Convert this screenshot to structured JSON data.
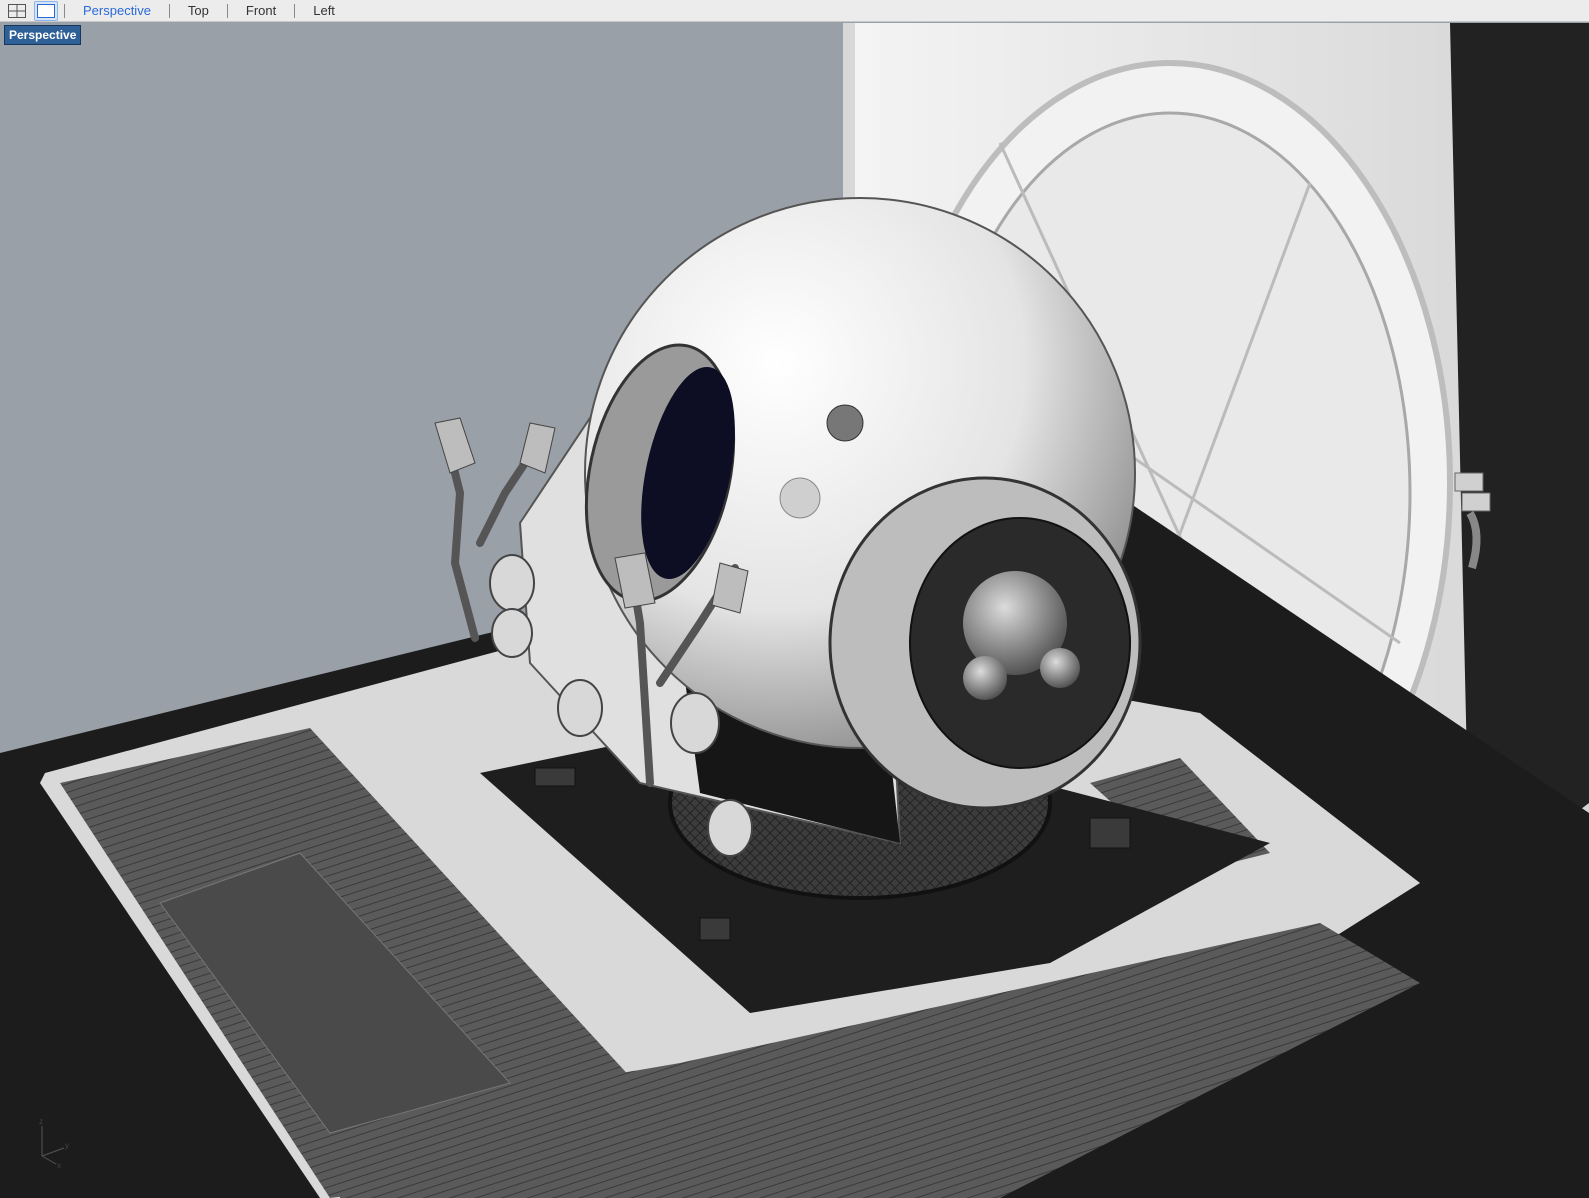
{
  "toolbar": {
    "layout_icon": "four-viewport-grid-icon",
    "single_icon": "single-viewport-icon",
    "tabs": [
      {
        "label": "Perspective",
        "active": true
      },
      {
        "label": "Top",
        "active": false
      },
      {
        "label": "Front",
        "active": false
      },
      {
        "label": "Left",
        "active": false
      }
    ],
    "accent_color": "#2a6ad6"
  },
  "viewport": {
    "label": "Perspective",
    "label_bg": "#2e5f96",
    "background": "#9aa0a8",
    "axes": {
      "x": "x",
      "y": "y",
      "z": "z"
    }
  }
}
